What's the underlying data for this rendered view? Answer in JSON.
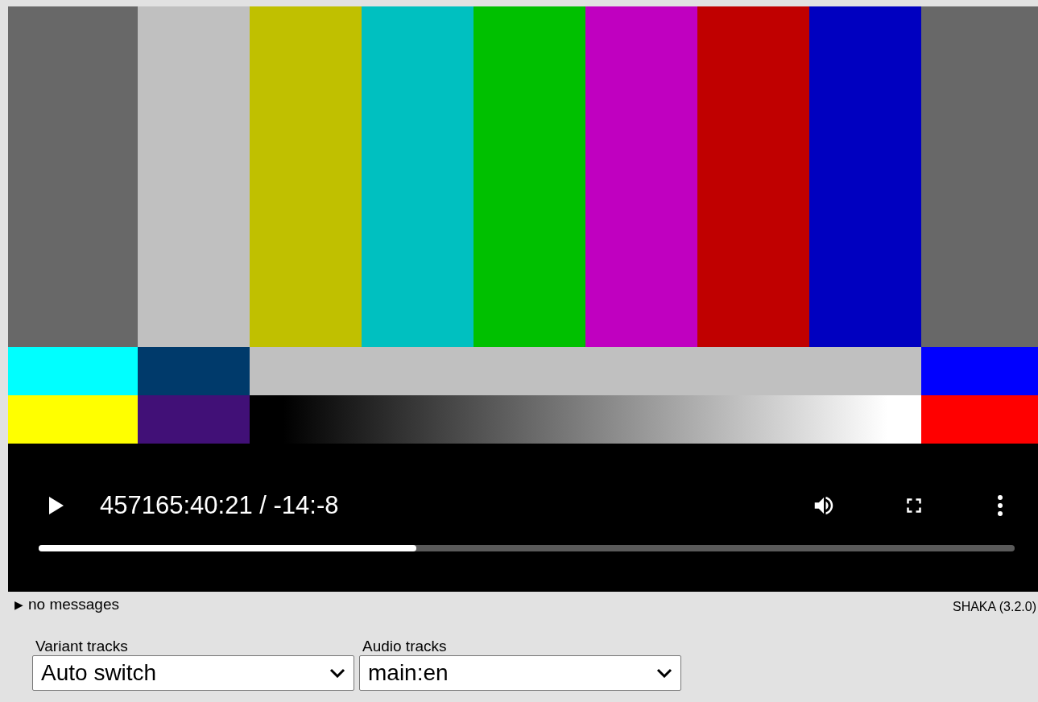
{
  "player": {
    "controls": {
      "playing": false,
      "time": "457165:40:21 / -14:-8",
      "muted": false
    },
    "seek_bar": {
      "level": 0.387
    }
  },
  "messages": {
    "marker": "▶",
    "text": "no messages"
  },
  "version": "SHAKA (3.2.0)",
  "selects": [
    {
      "label": "Variant tracks",
      "value": "Auto switch"
    },
    {
      "label": "Audio tracks",
      "value": "main:en"
    }
  ]
}
